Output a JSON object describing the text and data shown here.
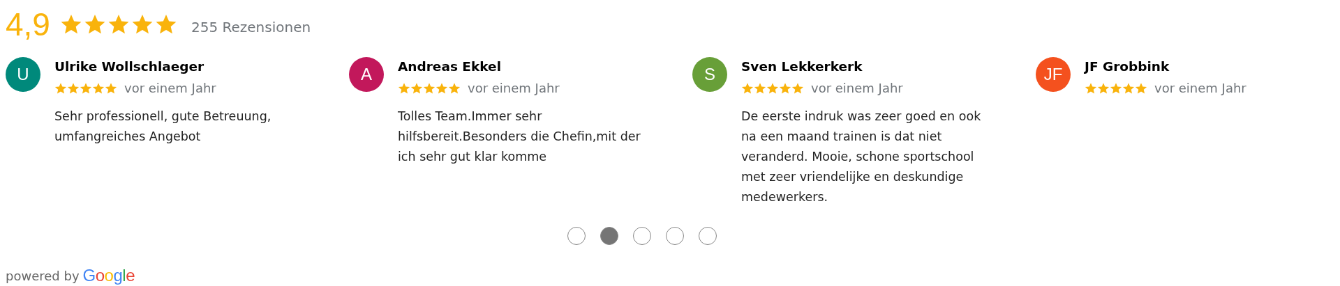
{
  "summary": {
    "rating": "4,9",
    "stars": 5,
    "count": "255 Rezensionen"
  },
  "reviews": [
    {
      "initials": "U",
      "color": "#00897b",
      "name": "Ulrike Wollschlaeger",
      "stars": 5,
      "time": "vor einem Jahr",
      "text": "Sehr professionell, gute Betreuung, umfangreiches Angebot"
    },
    {
      "initials": "A",
      "color": "#c2185b",
      "name": "Andreas Ekkel",
      "stars": 5,
      "time": "vor einem Jahr",
      "text": "Tolles Team.Immer sehr hilfsbereit.Besonders die Chefin,mit der ich sehr gut klar komme"
    },
    {
      "initials": "S",
      "color": "#689f38",
      "name": "Sven Lekkerkerk",
      "stars": 5,
      "time": "vor einem Jahr",
      "text": "De eerste indruk was zeer goed en ook na een maand trainen is dat niet veranderd. Mooie, schone sportschool met zeer vriendelijke en deskundige medewerkers."
    },
    {
      "initials": "JF",
      "color": "#f4511e",
      "name": "JF Grobbink",
      "stars": 5,
      "time": "vor einem Jahr"
    }
  ],
  "pagination": [
    {
      "selected": false
    },
    {
      "selected": true
    },
    {
      "selected": false
    },
    {
      "selected": false
    },
    {
      "selected": false
    }
  ],
  "footer": {
    "powered_by": "powered by",
    "logo": "Google"
  }
}
